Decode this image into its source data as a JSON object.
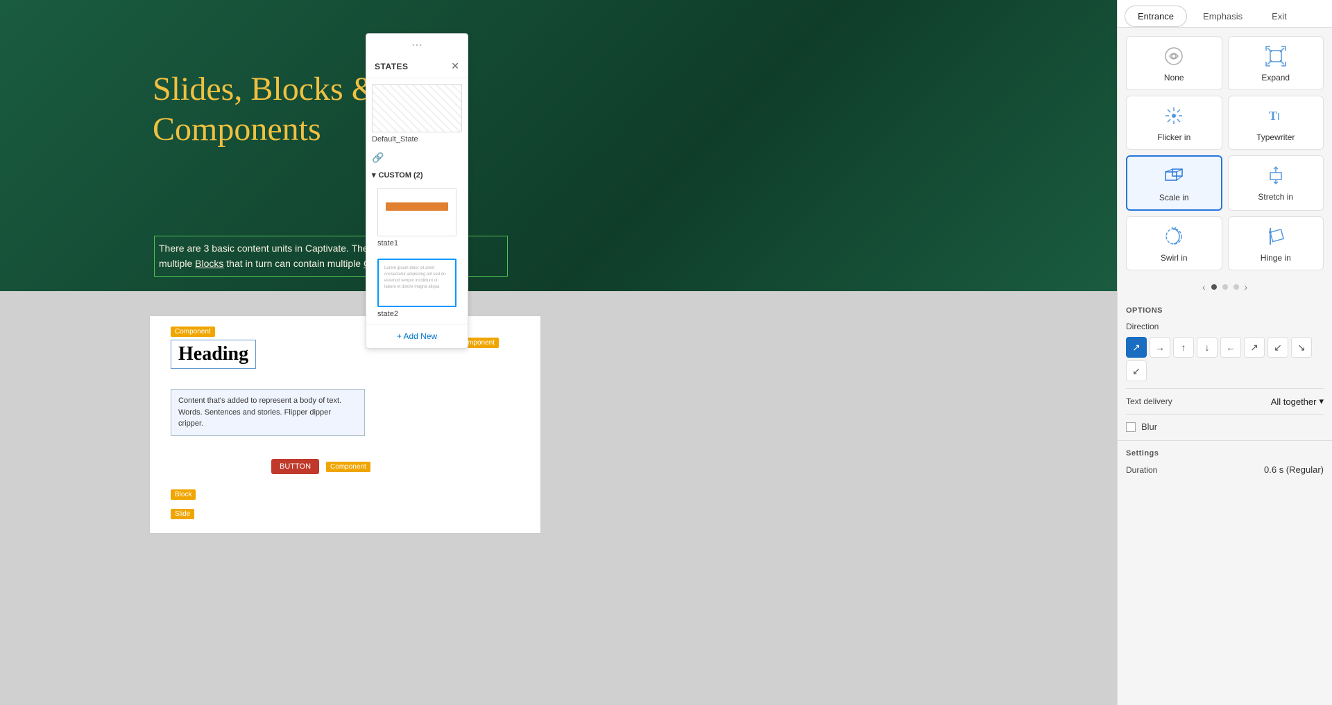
{
  "tabs": {
    "entrance": "Entrance",
    "emphasis": "Emphasis",
    "exit": "Exit",
    "active": "Entrance"
  },
  "animations": [
    {
      "id": "none",
      "label": "None",
      "icon": "none"
    },
    {
      "id": "expand",
      "label": "Expand",
      "icon": "expand"
    },
    {
      "id": "flicker_in",
      "label": "Flicker in",
      "icon": "flicker"
    },
    {
      "id": "typewriter",
      "label": "Typewriter",
      "icon": "typewriter"
    },
    {
      "id": "scale_in",
      "label": "Scale in",
      "icon": "scale",
      "selected": true
    },
    {
      "id": "stretch_in",
      "label": "Stretch in",
      "icon": "stretch"
    },
    {
      "id": "swirl_in",
      "label": "Swirl in",
      "icon": "swirl"
    },
    {
      "id": "hinge_in",
      "label": "Hinge in",
      "icon": "hinge"
    }
  ],
  "options": {
    "title": "OPTIONS",
    "direction_label": "Direction",
    "directions": [
      "diagonal-tl",
      "right",
      "up",
      "down",
      "left",
      "diagonal-tr",
      "diagonal-bl",
      "diagonal-br",
      "diagonal-extra"
    ],
    "text_delivery_label": "Text delivery",
    "text_delivery_value": "All together",
    "blur_label": "Blur",
    "blur_checked": false
  },
  "settings": {
    "title": "Settings",
    "duration_label": "Duration",
    "duration_value": "0.6 s (Regular)"
  },
  "states": {
    "title": "STATES",
    "items": [
      {
        "id": "default_state",
        "label": "Default_State",
        "selected": false
      },
      {
        "id": "state1",
        "label": "state1",
        "selected": false
      },
      {
        "id": "state2",
        "label": "state2",
        "selected": true
      }
    ],
    "custom_count": 2,
    "add_new_label": "+ Add New"
  },
  "slide": {
    "heading": "Slides, Blocks &\nComponents",
    "paragraph": "There are 3 basic content units in Captivate. The Slides that can contain multiple Blocks that in turn can contain multiple Components or objects.",
    "preview": {
      "heading": "Heading",
      "content": "Content that's added to represent a body of text. Words. Sentences and stories. Flipper dipper cripper.",
      "button": "BUTTON",
      "labels": [
        "Component",
        "Component",
        "Component",
        "Block",
        "Slide"
      ]
    }
  }
}
